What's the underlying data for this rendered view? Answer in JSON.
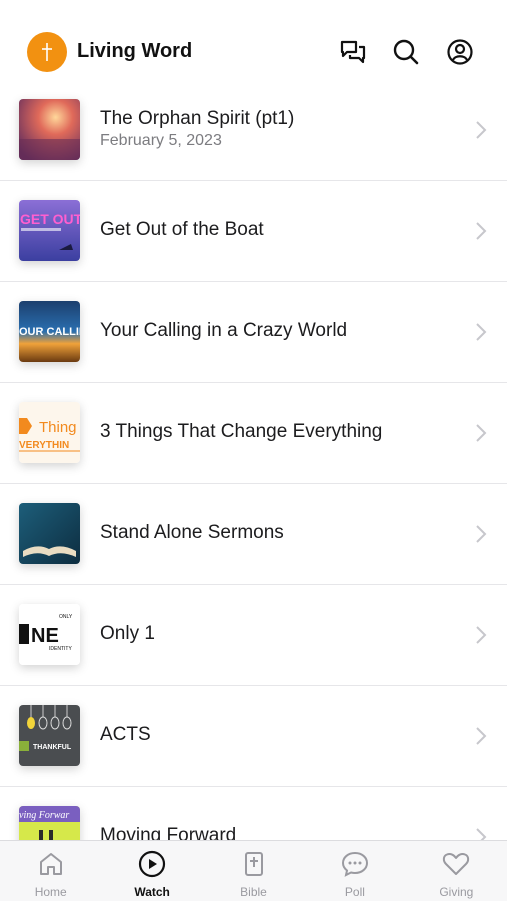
{
  "header": {
    "app_title": "Living Word",
    "logo_icon": "cross-icon",
    "icons": [
      "chat-bubbles-icon",
      "search-icon",
      "profile-icon"
    ],
    "accent": "#f29111"
  },
  "items": [
    {
      "title": "The Orphan Spirit (pt1)",
      "date": "February 5, 2023",
      "thumb_text": ""
    },
    {
      "title": "Get Out of the Boat",
      "date": "",
      "thumb_text": "GET OUT"
    },
    {
      "title": "Your Calling in a Crazy World",
      "date": "",
      "thumb_text": "OUR CALLIN"
    },
    {
      "title": "3 Things That Change Everything",
      "date": "",
      "thumb_text": "Thing",
      "thumb_text2": "VERYTHIN"
    },
    {
      "title": "Stand Alone Sermons",
      "date": "",
      "thumb_text": ""
    },
    {
      "title": "Only 1",
      "date": "",
      "thumb_text": "NE",
      "thumb_small_top": "ONLY",
      "thumb_small_bottom": "IDENTITY"
    },
    {
      "title": "ACTS",
      "date": "",
      "thumb_text": "THANKFUL"
    },
    {
      "title": "Moving Forward",
      "date": "",
      "thumb_text": "ving Forwar"
    }
  ],
  "tabs": [
    {
      "label": "Home",
      "icon": "home-icon",
      "active": false
    },
    {
      "label": "Watch",
      "icon": "play-circle-icon",
      "active": true
    },
    {
      "label": "Bible",
      "icon": "bible-icon",
      "active": false
    },
    {
      "label": "Poll",
      "icon": "poll-bubble-icon",
      "active": false
    },
    {
      "label": "Giving",
      "icon": "heart-icon",
      "active": false
    }
  ]
}
